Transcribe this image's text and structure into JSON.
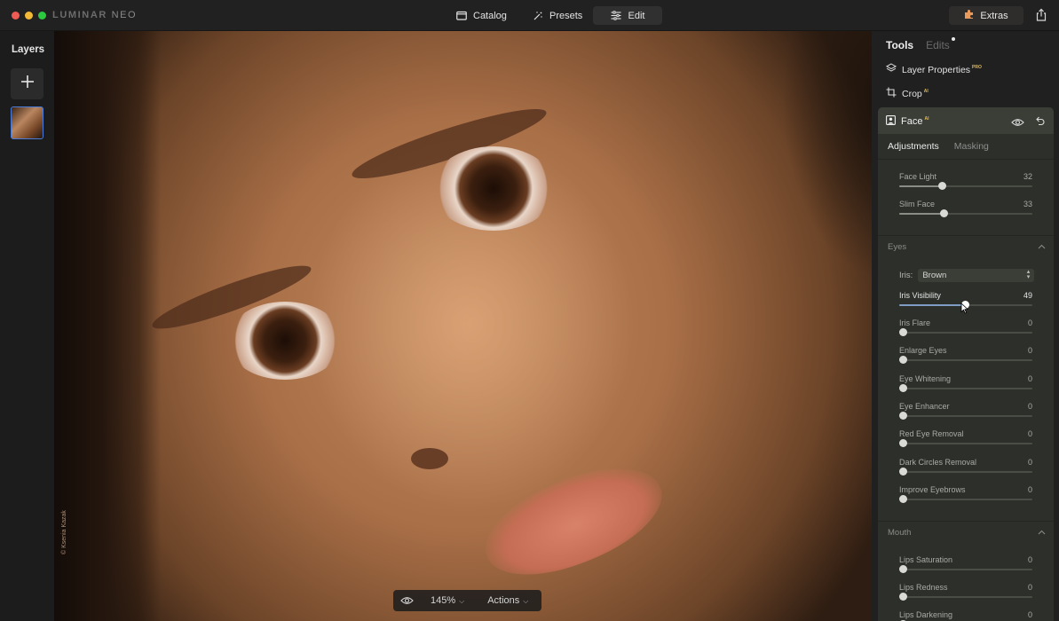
{
  "app": {
    "logo_main": "LUMINAR",
    "logo_neo": "NEO",
    "nav": {
      "catalog": "Catalog",
      "presets": "Presets",
      "edit": "Edit"
    },
    "extras": "Extras"
  },
  "layers": {
    "title": "Layers"
  },
  "canvas": {
    "watermark": "© Ksenia Kazak",
    "zoom": "145%",
    "actions": "Actions"
  },
  "panel": {
    "tab_tools": "Tools",
    "tab_edits": "Edits",
    "layer_properties": "Layer Properties",
    "layer_properties_badge": "PRO",
    "crop": "Crop",
    "crop_badge": "AI",
    "face": {
      "title": "Face",
      "badge": "AI",
      "subtab_adjustments": "Adjustments",
      "subtab_masking": "Masking",
      "face_light": {
        "label": "Face Light",
        "value": "32"
      },
      "slim_face": {
        "label": "Slim Face",
        "value": "33"
      },
      "eyes_section": "Eyes",
      "iris_label": "Iris:",
      "iris_value": "Brown",
      "iris_visibility": {
        "label": "Iris Visibility",
        "value": "49"
      },
      "iris_flare": {
        "label": "Iris Flare",
        "value": "0"
      },
      "enlarge_eyes": {
        "label": "Enlarge Eyes",
        "value": "0"
      },
      "eye_whitening": {
        "label": "Eye Whitening",
        "value": "0"
      },
      "eye_enhancer": {
        "label": "Eye Enhancer",
        "value": "0"
      },
      "red_eye_removal": {
        "label": "Red Eye Removal",
        "value": "0"
      },
      "dark_circles_removal": {
        "label": "Dark Circles Removal",
        "value": "0"
      },
      "improve_eyebrows": {
        "label": "Improve Eyebrows",
        "value": "0"
      },
      "mouth_section": "Mouth",
      "lips_saturation": {
        "label": "Lips Saturation",
        "value": "0"
      },
      "lips_redness": {
        "label": "Lips Redness",
        "value": "0"
      },
      "lips_darkening": {
        "label": "Lips Darkening",
        "value": "0"
      }
    }
  },
  "colors": {
    "accent_blue": "#4a7bd8",
    "badge_gold": "#e0b85a",
    "panel_card": "#2c2f2a"
  }
}
